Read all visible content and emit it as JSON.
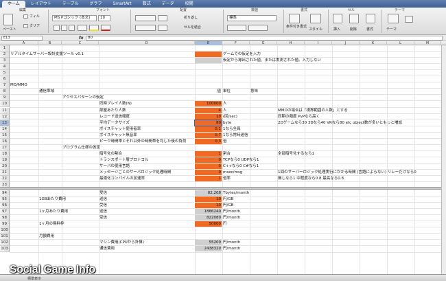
{
  "ribbon_tabs": [
    "ホーム",
    "レイアウト",
    "テーブル",
    "グラフ",
    "SmartArt",
    "数式",
    "データ",
    "校閲"
  ],
  "ribbon": {
    "groups": [
      "編集",
      "フォント",
      "配置",
      "数値",
      "書式",
      "セル",
      "テーマ"
    ],
    "fill_label": "フィル",
    "clear_label": "クリア",
    "paste_label": "ペースト",
    "font_name": "MS Pゴシック (本文)",
    "font_size": "10",
    "number_format": "標準",
    "wrap_label": "折り返し",
    "merge_label": "セルを結合",
    "conditional_label": "条件付き書式",
    "style_label": "スタイル",
    "insert_label": "挿入",
    "delete_label": "削除",
    "format_label": "書式",
    "theme_label": "テーマ"
  },
  "formula_bar": {
    "name_box": "E13",
    "fx": "fx",
    "value": "80"
  },
  "columns": [
    "A",
    "B",
    "C",
    "D",
    "E",
    "F",
    "G",
    "H",
    "I",
    "J",
    "K",
    "L",
    "M"
  ],
  "selected_column": "E",
  "selected_row": "13",
  "rows_top": [
    "1",
    "2",
    "3",
    "4",
    "5",
    "6",
    "7",
    "8",
    "9",
    "10",
    "11",
    "12",
    "13",
    "14",
    "15",
    "16",
    "17",
    "18",
    "19",
    "20",
    "21",
    "22",
    "23"
  ],
  "rows_bottom": [
    "94",
    "95",
    "96",
    "97",
    "98",
    "99",
    "100",
    "101",
    "102",
    "103"
  ],
  "cells": {
    "a2": "リアルタイムサーバー設計支援ツール v0.1",
    "f2": "ゲームでの仮定を入力",
    "f3": "仮定から導出された値、または実測された値。入力しない",
    "a7": "MO/MMO",
    "b8": "通信帯域",
    "e8": "値",
    "f8": "単位",
    "g8": "意味",
    "c9": "アクセスパターンの仮定",
    "d10": "同時プレイ人数(N)",
    "e10": "100000",
    "f10": "人",
    "d11": "部屋あたり人数",
    "e11": "4",
    "f11": "人",
    "h11": "MMOの場合は「視界範囲の人数」とする",
    "d12": "レコード送信頻度",
    "e12": "10",
    "f12": "(回/sec)",
    "h12": "同期の頻度 PvPなら高く",
    "d13": "平均データサイズ",
    "e13": "80",
    "f13": "byte",
    "h13": "2Dゲームなら30 3Dなら40 VRなら80 etc   object数が多いともっと増加",
    "d14": "ボイスチャット使用者率",
    "e14": "0.1",
    "f14": "1なら全員",
    "d15": "ボイスチャット無音率",
    "e15": "0.7",
    "f15": "1なら常時送信",
    "d16": "ピーク時間帯とそれ以外の時間帯を均した後の負荷",
    "e16": "0.3",
    "f16": "倍",
    "c17": "プログラム仕様の仮定",
    "d18": "暗号化の割合",
    "e18": "1",
    "f18": "割合",
    "h18": "全部暗号化するなら1",
    "d19": "トランスポート層プロトコル",
    "e19": "0",
    "f19": "TCPなら0 UDPなら1",
    "d20": "サーバの使用言語",
    "e20": "0",
    "f20": "C++なら0 C#なら1",
    "d21": "メッセージごとのサーバロジック処理時間",
    "e21": "0",
    "f21": "msec/msg",
    "h21": "1回のサーバーロジック処理実行にかかる時間 (言語によらない) リレーだけなら0",
    "d22": "最適化コンパイルの加速率",
    "e22": "1",
    "f22": "倍率",
    "h22": "無しなら1 中程度なら0.8 最高なら0.8",
    "d94": "受信",
    "e94": "82.208",
    "f94": "Tbytes/month",
    "b95": "1GBあたり費用",
    "d95": "送信",
    "e95": "10",
    "f95": "円/GB",
    "d96": "受信",
    "e96": "10",
    "f96": "円/GB",
    "b97": "1ヶ月あたり費用",
    "d97": "送信",
    "e97": "1886240",
    "f97": "円/month",
    "d98": "受信",
    "e98": "822080",
    "f98": "円/month",
    "b99": "1ヶ月の無料枠",
    "e99": "50000",
    "f99": "円",
    "b101": "月額費用",
    "d102": "マシン費用(CPUから計算)",
    "e102": "55200",
    "f102": "円/month",
    "d103": "通信費用",
    "e103": "2438320",
    "f103": "円/month"
  },
  "status_text": "標準表示",
  "watermark": "Social Game Info",
  "colors": {
    "input_fill": "#ef6a22",
    "derived_fill": "#cfcfcf",
    "selection": "#2e5fb3"
  }
}
